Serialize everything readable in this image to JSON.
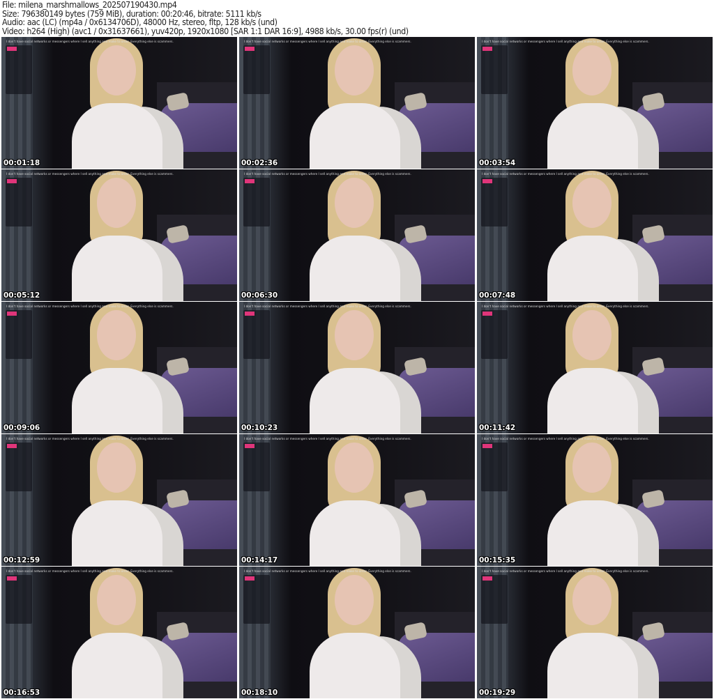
{
  "header": {
    "file": "File: milena_marshmallows_202507190430.mp4",
    "size": "Size: 796380149 bytes (759 MiB), duration: 00:20:46, bitrate: 5111 kb/s",
    "audio": "Audio: aac (LC) (mp4a / 0x6134706D), 48000 Hz, stereo, fltp, 128 kb/s (und)",
    "video": "Video: h264 (High) (avc1 / 0x31637661), yuv420p, 1920x1080 [SAR 1:1 DAR 16:9], 4988 kb/s, 30.00 fps(r) (und)"
  },
  "overlay_notice": "I don't have social networks or messengers where I sell anything and make to order. Everything else is scammers.",
  "thumbnails": [
    {
      "timestamp": "00:01:18"
    },
    {
      "timestamp": "00:02:36"
    },
    {
      "timestamp": "00:03:54"
    },
    {
      "timestamp": "00:05:12"
    },
    {
      "timestamp": "00:06:30"
    },
    {
      "timestamp": "00:07:48"
    },
    {
      "timestamp": "00:09:06"
    },
    {
      "timestamp": "00:10:23"
    },
    {
      "timestamp": "00:11:42"
    },
    {
      "timestamp": "00:12:59"
    },
    {
      "timestamp": "00:14:17"
    },
    {
      "timestamp": "00:15:35"
    },
    {
      "timestamp": "00:16:53"
    },
    {
      "timestamp": "00:18:10"
    },
    {
      "timestamp": "00:19:29"
    }
  ]
}
